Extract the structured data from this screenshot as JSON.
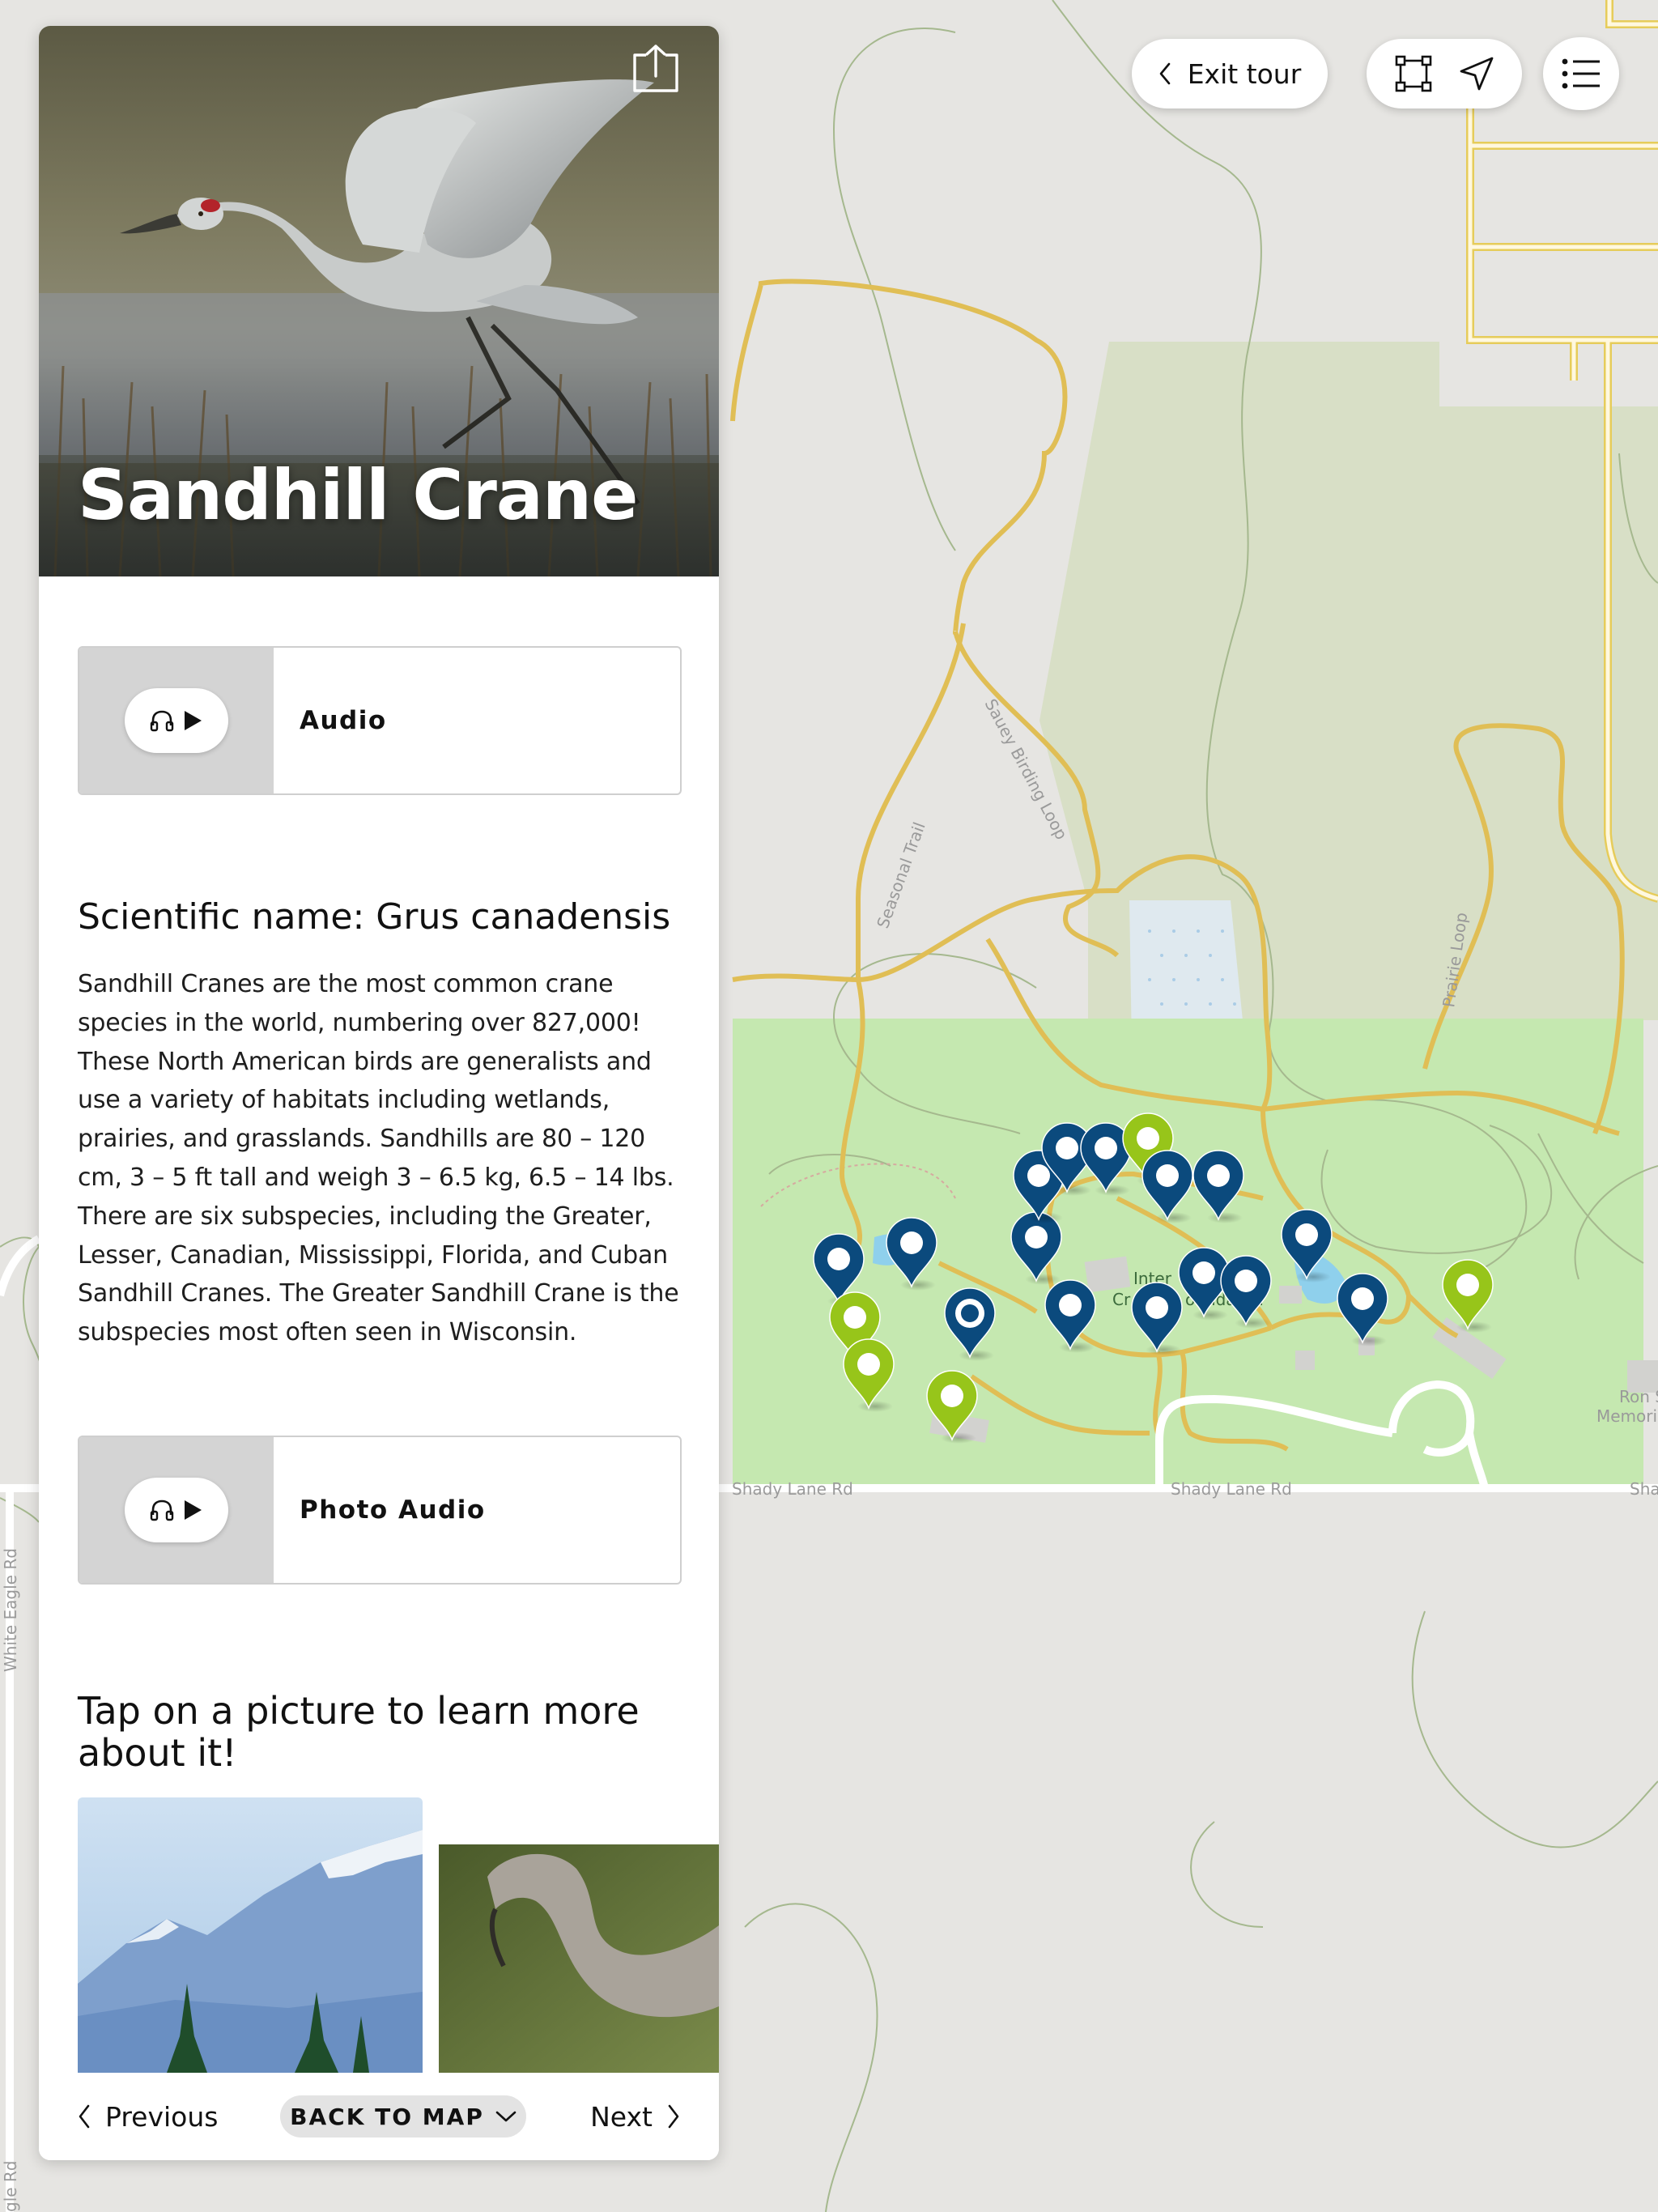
{
  "map": {
    "road_labels": [
      "Shady Lane Rd",
      "Shady Lane Rd",
      "Sha",
      "White Eagle Rd",
      "gle Rd",
      "Sauey Birding Loop",
      "Seasonal Trail",
      "Prairie Loop"
    ],
    "place_labels": [
      "Ron S",
      "Memoria",
      "Inter",
      "Cr",
      "oundat",
      "n"
    ],
    "marker_colors": {
      "blue": "#0b4a7d",
      "green": "#97c51a"
    }
  },
  "panel": {
    "title": "Sandhill Crane",
    "share_icon": "share-icon",
    "audio": {
      "label": "Audio",
      "icons": [
        "headphones-icon",
        "play-icon"
      ]
    },
    "scientific_name": "Scientific name: Grus canadensis",
    "description": "Sandhill Cranes are the most common crane species in the world, numbering over 827,000! These North American birds are generalists and use a variety of habitats including wetlands, prairies, and grasslands. Sandhills are 80 – 120 cm, 3 – 5 ft tall and weigh 3 – 6.5 kg, 6.5 – 14 lbs. There are six subspecies, including the Greater, Lesser, Canadian, Mississippi, Florida, and Cuban Sandhill Cranes. The Greater Sandhill Crane is the subspecies most often seen in Wisconsin.",
    "photo_audio": {
      "label": "Photo Audio"
    },
    "tap_prompt": "Tap on a picture to learn more about it!",
    "gallery": [
      "mountain-photo",
      "crane-neck-photo"
    ],
    "nav": {
      "previous": "Previous",
      "back_to_map": "BACK TO MAP",
      "next": "Next"
    }
  },
  "toolbar": {
    "exit_tour": "Exit tour",
    "icons": [
      "extent-icon",
      "locate-arrow-icon",
      "list-menu-icon"
    ]
  }
}
